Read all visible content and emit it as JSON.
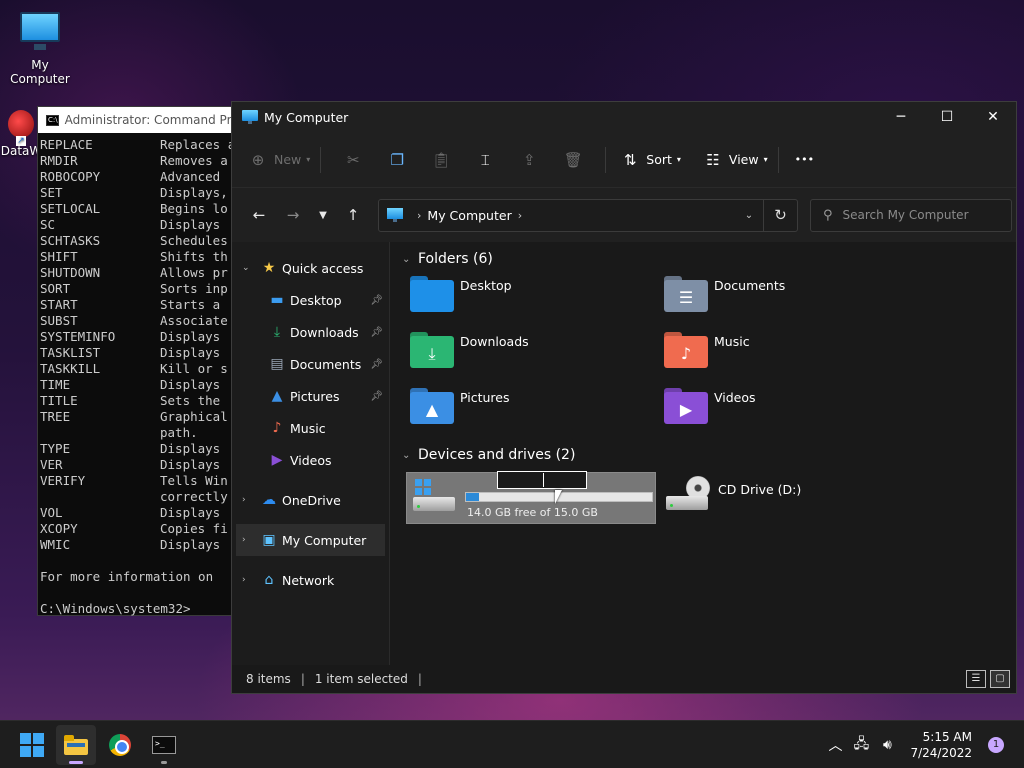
{
  "desktop": {
    "icons": [
      {
        "label": "My Computer"
      },
      {
        "label": "DataW"
      }
    ]
  },
  "cmd": {
    "title": "Administrator: Command Prompt",
    "rows": [
      {
        "cmd": "REPLACE",
        "desc": "Replaces a"
      },
      {
        "cmd": "RMDIR",
        "desc": "Removes a"
      },
      {
        "cmd": "ROBOCOPY",
        "desc": "Advanced"
      },
      {
        "cmd": "SET",
        "desc": "Displays,"
      },
      {
        "cmd": "SETLOCAL",
        "desc": "Begins lo"
      },
      {
        "cmd": "SC",
        "desc": "Displays"
      },
      {
        "cmd": "SCHTASKS",
        "desc": "Schedules"
      },
      {
        "cmd": "SHIFT",
        "desc": "Shifts th"
      },
      {
        "cmd": "SHUTDOWN",
        "desc": "Allows pr"
      },
      {
        "cmd": "SORT",
        "desc": "Sorts inp"
      },
      {
        "cmd": "START",
        "desc": "Starts a"
      },
      {
        "cmd": "SUBST",
        "desc": "Associate"
      },
      {
        "cmd": "SYSTEMINFO",
        "desc": "Displays"
      },
      {
        "cmd": "TASKLIST",
        "desc": "Displays"
      },
      {
        "cmd": "TASKKILL",
        "desc": "Kill or s"
      },
      {
        "cmd": "TIME",
        "desc": "Displays"
      },
      {
        "cmd": "TITLE",
        "desc": "Sets the"
      },
      {
        "cmd": "TREE",
        "desc": "Graphical"
      },
      {
        "cmd": "",
        "desc": "path."
      },
      {
        "cmd": "TYPE",
        "desc": "Displays"
      },
      {
        "cmd": "VER",
        "desc": "Displays"
      },
      {
        "cmd": "VERIFY",
        "desc": "Tells Win"
      },
      {
        "cmd": "",
        "desc": "correctly"
      },
      {
        "cmd": "VOL",
        "desc": "Displays"
      },
      {
        "cmd": "XCOPY",
        "desc": "Copies fi"
      },
      {
        "cmd": "WMIC",
        "desc": "Displays"
      },
      {
        "cmd": "",
        "desc": ""
      },
      {
        "cmd": "For more information on",
        "desc": ""
      },
      {
        "cmd": "",
        "desc": ""
      },
      {
        "cmd": "C:\\Windows\\system32>",
        "desc": ""
      }
    ]
  },
  "explorer": {
    "title": "My Computer",
    "toolbar": {
      "new_label": "New",
      "sort_label": "Sort",
      "view_label": "View",
      "more_label": "•••"
    },
    "address": {
      "crumb": "My Computer"
    },
    "search": {
      "placeholder": "Search My Computer"
    },
    "sidebar": {
      "quick_access": "Quick access",
      "items": [
        {
          "label": "Desktop"
        },
        {
          "label": "Downloads"
        },
        {
          "label": "Documents"
        },
        {
          "label": "Pictures"
        },
        {
          "label": "Music"
        },
        {
          "label": "Videos"
        }
      ],
      "onedrive": "OneDrive",
      "mycomputer": "My Computer",
      "network": "Network"
    },
    "folders_header": "Folders (6)",
    "folders": [
      {
        "name": "Desktop",
        "color": "#1e90e8",
        "glyph": ""
      },
      {
        "name": "Documents",
        "color": "#7e8fa6",
        "glyph": "☰"
      },
      {
        "name": "Downloads",
        "color": "#2bb673",
        "glyph": "⤓"
      },
      {
        "name": "Music",
        "color": "#f06b4f",
        "glyph": "♪"
      },
      {
        "name": "Pictures",
        "color": "#3b8fe4",
        "glyph": "▲"
      },
      {
        "name": "Videos",
        "color": "#8a4fd6",
        "glyph": "▶"
      }
    ],
    "drives_header": "Devices and drives (2)",
    "drives": {
      "c_free_text": "14.0 GB free of 15.0 GB",
      "c_used_fraction": 0.07,
      "d_label": "CD Drive (D:)"
    },
    "status": {
      "items": "8 items",
      "selected": "1 item selected"
    }
  },
  "taskbar": {
    "time": "5:15 AM",
    "date": "7/24/2022",
    "notification_count": "1"
  }
}
